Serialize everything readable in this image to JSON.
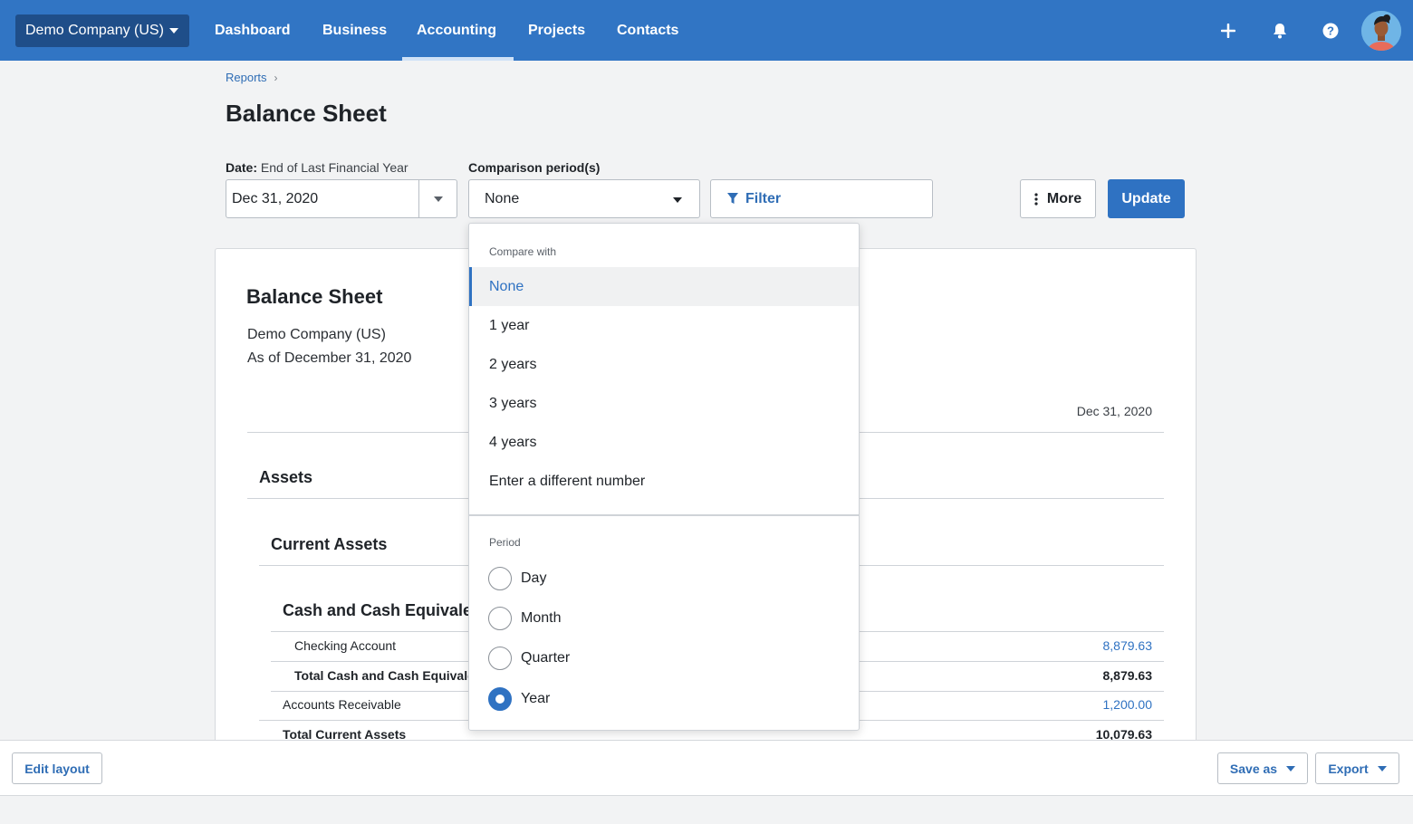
{
  "topnav": {
    "org": "Demo Company (US)",
    "items": [
      "Dashboard",
      "Business",
      "Accounting",
      "Projects",
      "Contacts"
    ],
    "active": "Accounting",
    "icons": [
      "plus-icon",
      "bell-icon",
      "help-icon",
      "avatar"
    ]
  },
  "breadcrumb": {
    "parent": "Reports"
  },
  "page_title": "Balance Sheet",
  "controls": {
    "date_label_bold": "Date:",
    "date_label_rest": "End of Last Financial Year",
    "date_value": "Dec 31, 2020",
    "comparison_label": "Comparison period(s)",
    "comparison_value": "None",
    "filter_label": "Filter",
    "more_label": "More",
    "update_label": "Update"
  },
  "report": {
    "title": "Balance Sheet",
    "company": "Demo Company (US)",
    "as_of": "As of December 31, 2020",
    "column": "Dec 31, 2020",
    "assets": "Assets",
    "current_assets": "Current Assets",
    "cash_section": "Cash and Cash Equivalents",
    "rows": [
      {
        "label": "Checking Account",
        "value": "8,879.63"
      },
      {
        "label": "Total Cash and Cash Equivalents",
        "value": "8,879.63"
      },
      {
        "label": "Accounts Receivable",
        "value": "1,200.00"
      },
      {
        "label": "Total Current Assets",
        "value": "10,079.63"
      }
    ]
  },
  "dropdown": {
    "compare_heading": "Compare with",
    "options": [
      "None",
      "1 year",
      "2 years",
      "3 years",
      "4 years",
      "Enter a different number"
    ],
    "selected_option": "None",
    "period_heading": "Period",
    "periods": [
      "Day",
      "Month",
      "Quarter",
      "Year"
    ],
    "selected_period": "Year"
  },
  "bottombar": {
    "edit_layout": "Edit layout",
    "save_as": "Save as",
    "export": "Export"
  },
  "colors": {
    "nav": "#3175c4",
    "accent": "#2f72c2",
    "org_button": "#1f4e89"
  }
}
